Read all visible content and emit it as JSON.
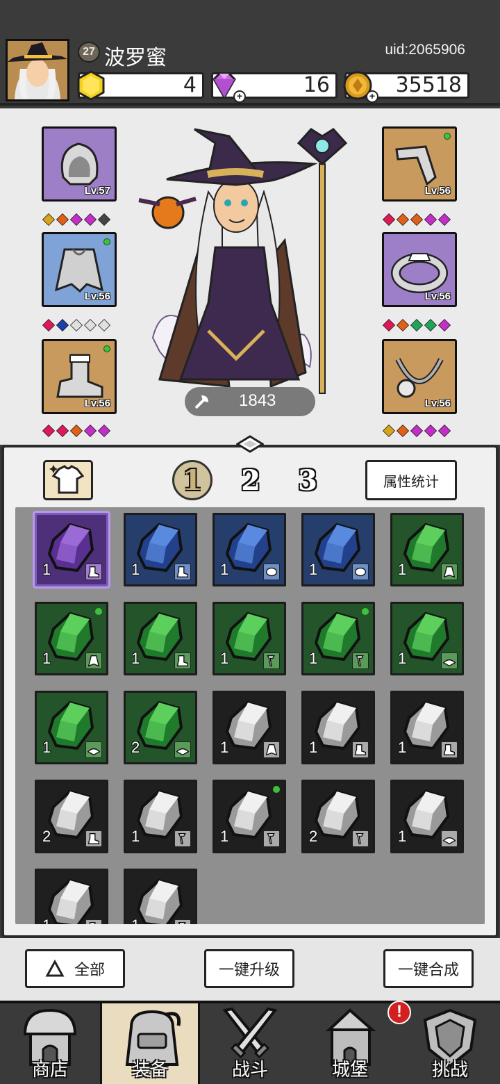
{
  "player": {
    "level": "27",
    "name": "波罗蜜",
    "uid": "uid:2065906"
  },
  "resources": {
    "energy": "4",
    "gems": "16",
    "gold": "35518"
  },
  "equipment": {
    "left": [
      {
        "name": "hood",
        "level": "Lv.57",
        "rarity": "purple",
        "new": false
      },
      {
        "name": "cloak",
        "level": "Lv.56",
        "rarity": "blue",
        "new": true
      },
      {
        "name": "boots",
        "level": "Lv.56",
        "rarity": "brown",
        "new": true
      }
    ],
    "right": [
      {
        "name": "weapon",
        "level": "Lv.56",
        "rarity": "brown",
        "new": true
      },
      {
        "name": "ring",
        "level": "Lv.56",
        "rarity": "purple",
        "new": false
      },
      {
        "name": "necklace",
        "level": "Lv.56",
        "rarity": "brown",
        "new": false
      }
    ]
  },
  "power": "1843",
  "colors": {
    "gem_red": "#e0185a",
    "gem_orange": "#e0601a",
    "gem_magenta": "#c22fc8",
    "gem_gray": "#444444",
    "gem_blue": "#1c3fa8",
    "gem_white": "#e0e0e0",
    "gem_green": "#21a35a",
    "gem_yellow": "#d6a51c"
  },
  "inventory": {
    "pages": [
      "1",
      "2",
      "3"
    ],
    "active_page": "1",
    "stats_label": "属性统计",
    "items": [
      {
        "rarity": "purple",
        "count": "1",
        "tag": "boot"
      },
      {
        "rarity": "blue",
        "count": "1",
        "tag": "boot"
      },
      {
        "rarity": "blue",
        "count": "1",
        "tag": "ring"
      },
      {
        "rarity": "blue",
        "count": "1",
        "tag": "ring"
      },
      {
        "rarity": "green",
        "count": "1",
        "tag": "cloak"
      },
      {
        "rarity": "green",
        "count": "1",
        "tag": "cloak",
        "new": true
      },
      {
        "rarity": "green",
        "count": "1",
        "tag": "boot"
      },
      {
        "rarity": "green",
        "count": "1",
        "tag": "wand"
      },
      {
        "rarity": "green",
        "count": "1",
        "tag": "wand",
        "new": true
      },
      {
        "rarity": "green",
        "count": "1",
        "tag": "hat"
      },
      {
        "rarity": "green",
        "count": "1",
        "tag": "hat"
      },
      {
        "rarity": "green",
        "count": "2",
        "tag": "hat"
      },
      {
        "rarity": "gray",
        "count": "1",
        "tag": "cloak"
      },
      {
        "rarity": "gray",
        "count": "1",
        "tag": "boot"
      },
      {
        "rarity": "gray",
        "count": "1",
        "tag": "boot"
      },
      {
        "rarity": "gray",
        "count": "2",
        "tag": "boot"
      },
      {
        "rarity": "gray",
        "count": "1",
        "tag": "wand"
      },
      {
        "rarity": "gray",
        "count": "1",
        "tag": "wand",
        "new": true
      },
      {
        "rarity": "gray",
        "count": "2",
        "tag": "wand"
      },
      {
        "rarity": "gray",
        "count": "1",
        "tag": "hat"
      },
      {
        "rarity": "gray",
        "count": "1",
        "tag": "boot"
      },
      {
        "rarity": "gray",
        "count": "1",
        "tag": "wand"
      }
    ]
  },
  "actions": {
    "filter_all": "全部",
    "upgrade_all": "一键升级",
    "merge_all": "一键合成"
  },
  "nav": {
    "items": [
      {
        "label": "商店",
        "icon": "shop-icon"
      },
      {
        "label": "装备",
        "icon": "bag-icon"
      },
      {
        "label": "战斗",
        "icon": "swords-icon"
      },
      {
        "label": "城堡",
        "icon": "castle-icon"
      },
      {
        "label": "挑战",
        "icon": "shield-icon"
      }
    ],
    "active": "装备",
    "alert": "!"
  }
}
